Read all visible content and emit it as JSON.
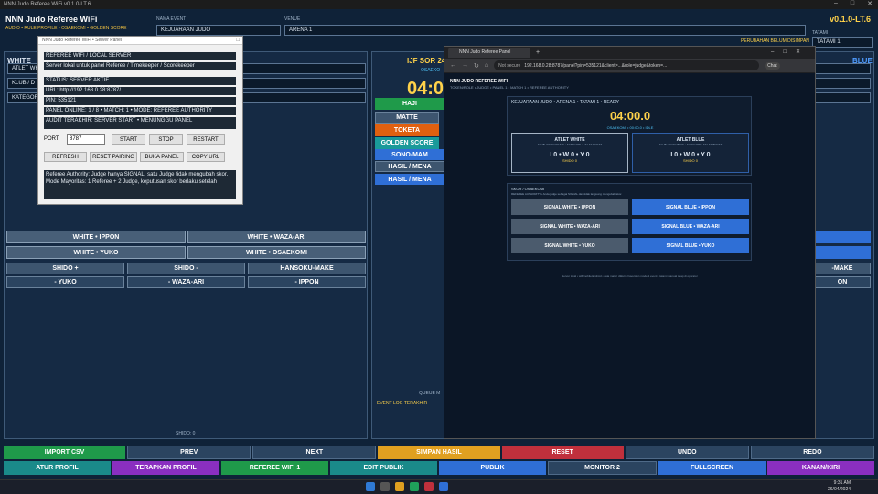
{
  "window": {
    "title": "NNN Judo Referee WiFi v0.1.0-LT.6"
  },
  "app": {
    "title": "NNN Judo Referee WiFi",
    "subtitle": "AUDIO • RULE PROFILE • OSAEKOMI • GOLDEN SCORE",
    "version": "v0.1.0-LT.6"
  },
  "event": {
    "name_label": "NAMA EVENT",
    "name": "KEJUARAAN JUDO",
    "venue_label": "VENUE",
    "venue": "ARENA 1",
    "tatami_label": "TATAMI",
    "tatami": "TATAMI 1",
    "unsaved": "PERUBAHAN BELUM DISIMPAN"
  },
  "left": {
    "header": "WHITE",
    "athlete": "ATLET WH",
    "club": "KLUB / D",
    "category": "KATEGORI",
    "shido_footer": "SHIDO: 0"
  },
  "right": {
    "header": "BLUE"
  },
  "center": {
    "title": "IJF SOR 24",
    "osae": "OSAEKO",
    "timer": "04:0",
    "hajime": "HAJI",
    "matte": "MATTE",
    "toketa": "TOKETA",
    "golden": "GOLDEN SCORE",
    "sono": "SONO-MAM",
    "hasil1": "HASIL / MENA",
    "hasil2": "HASIL / MENA",
    "queue": "QUEUE M",
    "log": "EVENT LOG TERAKHIR"
  },
  "scorebtns": {
    "w_ippon": "WHITE • IPPON",
    "w_wazaari": "WHITE • WAZA-ARI",
    "w_yuko": "WHITE • YUKO",
    "w_osaekomi": "WHITE • OSAEKOMI",
    "shido_plus": "SHIDO +",
    "shido_minus": "SHIDO -",
    "hansoku": "HANSOKU-MAKE",
    "m_yuko": "- YUKO",
    "m_wazaari": "- WAZA-ARI",
    "m_ippon": "- IPPON",
    "r_make": "-MAKE",
    "r_on": "ON"
  },
  "dialog": {
    "title": "NNN Judo Referee WiFi • Server Panel",
    "lines": [
      "REFEREE WIFI / LOCAL SERVER",
      "Server lokal untuk panel Referee / Timekeeper / Scorekeeper",
      "STATUS: SERVER AKTIF",
      "URL: http://192.168.0.28:8787/",
      "PIN: 535121",
      "PANEL ONLINE: 1 / 8   •   MATCH: 1   •   MODE: REFEREE AUTHORITY",
      "AUDIT TERAKHIR: SERVER START • MENUNGGU PANEL"
    ],
    "port_label": "PORT",
    "port": "8787",
    "start": "START",
    "stop": "STOP",
    "restart": "RESTART",
    "refresh": "REFRESH",
    "reset_pairing": "RESET PAIRING",
    "buka_panel": "BUKA PANEL",
    "copy_url": "COPY URL",
    "info1": "Referee Authority: Judge hanya SIGNAL; satu Judge tidak mengubah skor.",
    "info2": "Mode Mayoritas: 1 Referee + 2 Judge, keputusan skor berlaku setelah"
  },
  "browser": {
    "tab": "NNN Judo Referee Panel",
    "new_tab": "+",
    "not_secure": "Not secure",
    "url": "192.168.0.28:8787/panel?pin=535121&client=...&role=judge&token=...",
    "chat": "Chat",
    "app_title": "NNN JUDO REFEREE WIFI",
    "app_sub": "TOKEN/ROLE • JUDGE • PANEL 1 • MATCH 1 • REFEREE AUTHORITY",
    "match_line": "KEJUARAAN JUDO • ARENA 1 • TATAMI 1 • READY",
    "timer": "04:00.0",
    "osae": "OSAEKOMI • 00:00.0 • IDLE",
    "white_title": "ATLET WHITE",
    "white_sub": "KLUB / DOJO WHITE • KATEGORI • KELAS BERAT",
    "white_score": "I 0 • W 0 • Y 0",
    "white_shido": "SHIDO 0",
    "blue_title": "ATLET BLUE",
    "blue_sub": "KLUB / DOJO BLUE • KATEGORI • KELAS BERAT",
    "blue_score": "I 0 • W 0 • Y 0",
    "blue_shido": "SHIDO 0",
    "skor_label": "SKOR / OSAEKOMI",
    "skor_note": "REFEREE AUTHORITY • Anda judge sebagai SIGNAL dan tidak langsung mengubah skor.",
    "sig_w_ippon": "SIGNAL WHITE • IPPON",
    "sig_b_ippon": "SIGNAL BLUE • IPPON",
    "sig_w_waza": "SIGNAL WHITE • WAZA-ARI",
    "sig_b_waza": "SIGNAL BLUE • WAZA-ARI",
    "sig_w_yuko": "SIGNAL WHITE • YUKO",
    "sig_b_yuko": "SIGNAL BLUE • YUKO",
    "footer": "Server lokal • wifi/mobile/android • data match diikuti • haversion mode 1 event • tatami manual tetap di operator"
  },
  "bottom_row1": [
    "IMPORT CSV",
    "PREV",
    "NEXT",
    "SIMPAN HASIL",
    "RESET",
    "UNDO",
    "REDO"
  ],
  "bottom_row2": [
    "ATUR PROFIL",
    "TERAPKAN PROFIL",
    "REFEREE WIFI 1",
    "EDIT PUBLIK",
    "PUBLIK",
    "MONITOR 2",
    "FULLSCREEN",
    "KANAN/KIRI"
  ],
  "taskbar": {
    "time": "9:31 AM",
    "date": "26/04/2024"
  },
  "colors": {
    "bg": "#0f2238",
    "accent": "#ffd24a",
    "blue": "#2f6fd6",
    "green": "#1f9a4a",
    "red": "#c0303c",
    "purple": "#8a2fc0",
    "orange": "#e0a020"
  }
}
